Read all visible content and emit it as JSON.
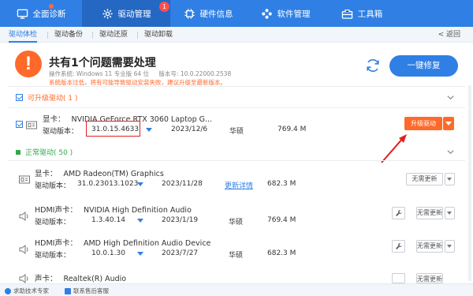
{
  "nav": {
    "tabs": [
      {
        "label": "全面诊断",
        "icon": "monitor-icon"
      },
      {
        "label": "驱动管理",
        "icon": "gear-icon",
        "badge": "1"
      },
      {
        "label": "硬件信息",
        "icon": "chip-icon"
      },
      {
        "label": "软件管理",
        "icon": "apps-icon"
      },
      {
        "label": "工具箱",
        "icon": "toolbox-icon"
      }
    ]
  },
  "subnav": {
    "tabs": [
      "驱动体检",
      "驱动备份",
      "驱动还原",
      "驱动卸载"
    ],
    "back": "< 返回"
  },
  "header": {
    "title": "共有1个问题需要处理",
    "os": "操作系统: Windows 11 专业版 64 位",
    "version": "版本号: 10.0.22000.2538",
    "warning": "系统版本过低，将有可能导致驱动安装失败，建议升级至最新版本。",
    "fix_button": "一键修复"
  },
  "sections": {
    "upgradable": "可升级驱动( 1 )",
    "normal": "正常驱动( 50 )"
  },
  "rows": [
    {
      "type": "显卡：",
      "name": "NVIDIA GeForce RTX 3060 Laptop G...",
      "ver_label": "驱动版本：",
      "version": "31.0.15.4633",
      "date": "2023/12/6",
      "vendor": "华硕",
      "size": "769.4 M",
      "action": "升级驱动"
    },
    {
      "type": "显卡：",
      "name": "AMD Radeon(TM) Graphics",
      "ver_label": "驱动版本：",
      "version": "31.0.23013.1023",
      "date": "2023/11/28",
      "vendor": "更新详情",
      "size": "682.3 M",
      "action": "无需更新"
    },
    {
      "type": "HDMI声卡：",
      "name": "NVIDIA High Definition Audio",
      "ver_label": "驱动版本：",
      "version": "1.3.40.14",
      "date": "2023/1/19",
      "vendor": "华硕",
      "size": "769.4 M",
      "action": "无需更新"
    },
    {
      "type": "HDMI声卡：",
      "name": "AMD High Definition Audio Device",
      "ver_label": "驱动版本：",
      "version": "10.0.1.30",
      "date": "2023/7/27",
      "vendor": "华硕",
      "size": "682.3 M",
      "action": "无需更新"
    },
    {
      "type": "声卡：",
      "name": "Realtek(R) Audio",
      "action": "无需更新"
    }
  ],
  "footer": {
    "help": "求助技术专家",
    "service": "联系售后客服"
  },
  "colors": {
    "primary": "#2f7fe5",
    "warning": "#ff6a2a",
    "ok": "#2faa4a"
  }
}
